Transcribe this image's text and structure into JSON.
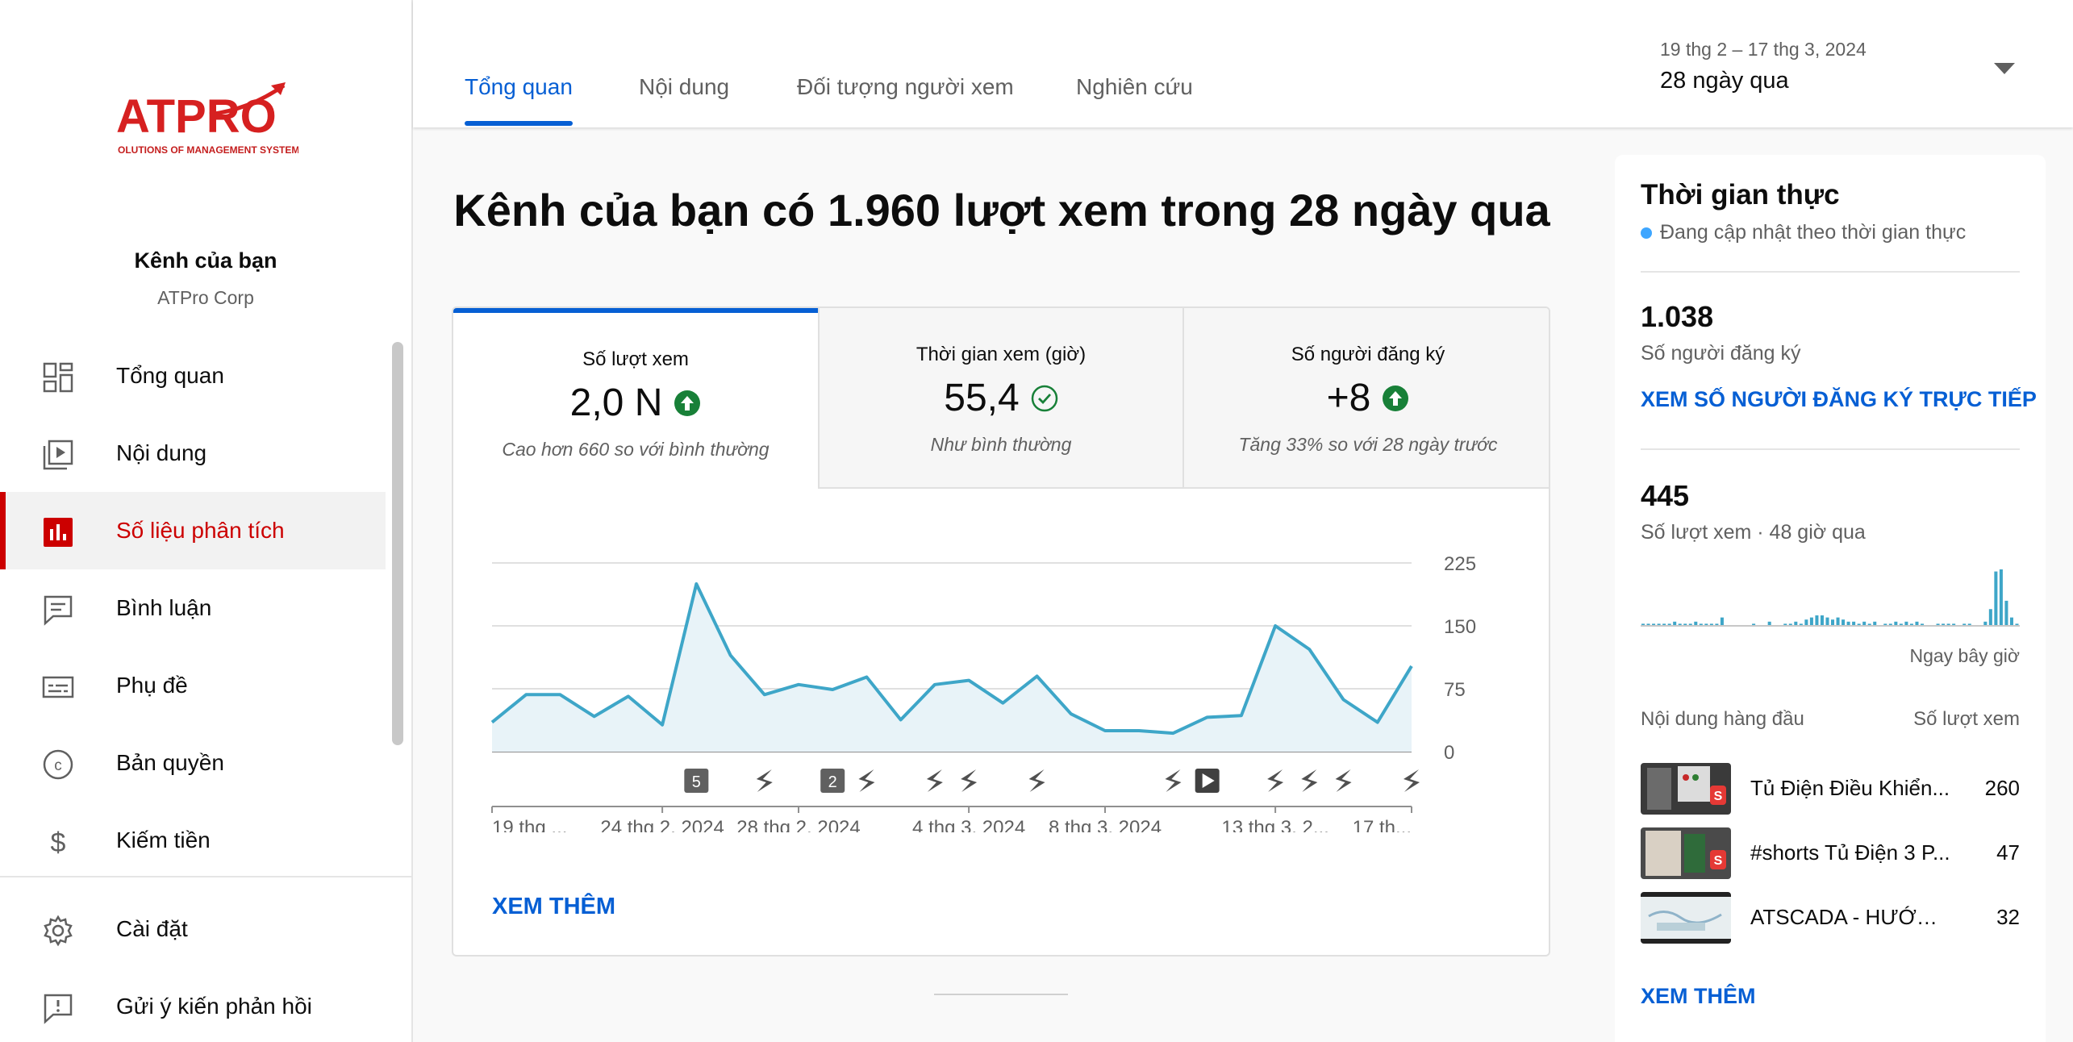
{
  "sidebar": {
    "logo_text": "ATPRO",
    "logo_tagline": "OLUTIONS OF MANAGEMENT SYSTEM",
    "channel_label": "Kênh của bạn",
    "channel_name": "ATPro Corp",
    "items": [
      {
        "label": "Tổng quan",
        "icon": "dashboard-icon",
        "active": false
      },
      {
        "label": "Nội dung",
        "icon": "content-icon",
        "active": false
      },
      {
        "label": "Số liệu phân tích",
        "icon": "analytics-icon",
        "active": true
      },
      {
        "label": "Bình luận",
        "icon": "comments-icon",
        "active": false
      },
      {
        "label": "Phụ đề",
        "icon": "subtitles-icon",
        "active": false
      },
      {
        "label": "Bản quyền",
        "icon": "copyright-icon",
        "active": false
      },
      {
        "label": "Kiếm tiền",
        "icon": "dollar-icon",
        "active": false
      }
    ],
    "bottom_items": [
      {
        "label": "Cài đặt",
        "icon": "gear-icon"
      },
      {
        "label": "Gửi ý kiến phản hồi",
        "icon": "feedback-icon"
      }
    ]
  },
  "header": {
    "tabs": [
      "Tổng quan",
      "Nội dung",
      "Đối tượng người xem",
      "Nghiên cứu"
    ],
    "active_tab": 0,
    "date_range": "19 thg 2 – 17 thg 3, 2024",
    "period": "28 ngày qua"
  },
  "main": {
    "headline": "Kênh của bạn có 1.960 lượt xem trong 28 ngày qua",
    "metrics": [
      {
        "title": "Số lượt xem",
        "value": "2,0 N",
        "status_icon": "arrow-up-circle-icon",
        "note": "Cao hơn 660 so với bình thường",
        "active": true
      },
      {
        "title": "Thời gian xem (giờ)",
        "value": "55,4",
        "status_icon": "check-circle-icon",
        "note": "Như bình thường",
        "active": false
      },
      {
        "title": "Số người đăng ký",
        "value": "+8",
        "status_icon": "arrow-up-circle-icon",
        "note": "Tăng 33% so với 28 ngày trước",
        "active": false
      }
    ],
    "see_more": "XEM THÊM"
  },
  "chart_data": {
    "type": "area",
    "title": "",
    "xlabel": "",
    "ylabel": "",
    "ylim": [
      0,
      225
    ],
    "y_ticks": [
      0,
      75,
      150,
      225
    ],
    "x_tick_labels": [
      "19 thg ...",
      "24 thg 2, 2024",
      "28 thg 2, 2024",
      "4 thg 3, 2024",
      "8 thg 3, 2024",
      "13 thg 3, 2...",
      "17 th..."
    ],
    "x_tick_index": [
      0,
      5,
      9,
      14,
      18,
      23,
      27
    ],
    "values": [
      35,
      68,
      68,
      42,
      66,
      32,
      200,
      115,
      68,
      80,
      74,
      89,
      38,
      80,
      85,
      58,
      90,
      45,
      25,
      25,
      22,
      41,
      43,
      150,
      122,
      62,
      35,
      102
    ],
    "color": "#3ea6c8",
    "markers": [
      {
        "index": 6,
        "type": "count",
        "label": "5"
      },
      {
        "index": 8,
        "type": "short"
      },
      {
        "index": 10,
        "type": "count",
        "label": "2"
      },
      {
        "index": 11,
        "type": "short"
      },
      {
        "index": 13,
        "type": "short"
      },
      {
        "index": 14,
        "type": "short"
      },
      {
        "index": 16,
        "type": "short"
      },
      {
        "index": 20,
        "type": "short"
      },
      {
        "index": 21,
        "type": "video"
      },
      {
        "index": 23,
        "type": "short"
      },
      {
        "index": 24,
        "type": "short"
      },
      {
        "index": 25,
        "type": "short"
      },
      {
        "index": 27,
        "type": "short"
      }
    ]
  },
  "realtime": {
    "title": "Thời gian thực",
    "subtitle": "Đang cập nhật theo thời gian thực",
    "subscribers": "1.038",
    "subscribers_label": "Số người đăng ký",
    "live_subs_link": "XEM SỐ NGƯỜI ĐĂNG KÝ TRỰC TIẾP",
    "views": "445",
    "views_label": "Số lượt xem · 48 giờ qua",
    "now_label": "Ngay bây giờ",
    "top_content_label": "Nội dung hàng đầu",
    "views_col_label": "Số lượt xem",
    "hourly_views": [
      1,
      1,
      1,
      1,
      1,
      1,
      2,
      1,
      1,
      1,
      2,
      1,
      1,
      1,
      1,
      4,
      0,
      0,
      0,
      0,
      0,
      1,
      0,
      0,
      2,
      0,
      0,
      1,
      1,
      2,
      1,
      3,
      4,
      5,
      5,
      4,
      3,
      4,
      3,
      2,
      2,
      1,
      2,
      1,
      2,
      0,
      1,
      1,
      2,
      1,
      2,
      1,
      2,
      1,
      0,
      0,
      1,
      1,
      1,
      1,
      0,
      1,
      1,
      0,
      0,
      2,
      8,
      26,
      27,
      12,
      4,
      1
    ],
    "top_videos": [
      {
        "title": "Tủ Điện Điều Khiển...",
        "views": "260"
      },
      {
        "title": "#shorts Tủ Điện 3 P...",
        "views": "47"
      },
      {
        "title": "ATSCADA - HƯỚNG ...",
        "views": "32"
      }
    ],
    "see_more": "XEM THÊM"
  },
  "colors": {
    "brand_red": "#cc0000",
    "link_blue": "#065fd4",
    "status_green": "#188038",
    "chart_line": "#3ea6c8",
    "realtime_bar": "#3ea6c8"
  }
}
